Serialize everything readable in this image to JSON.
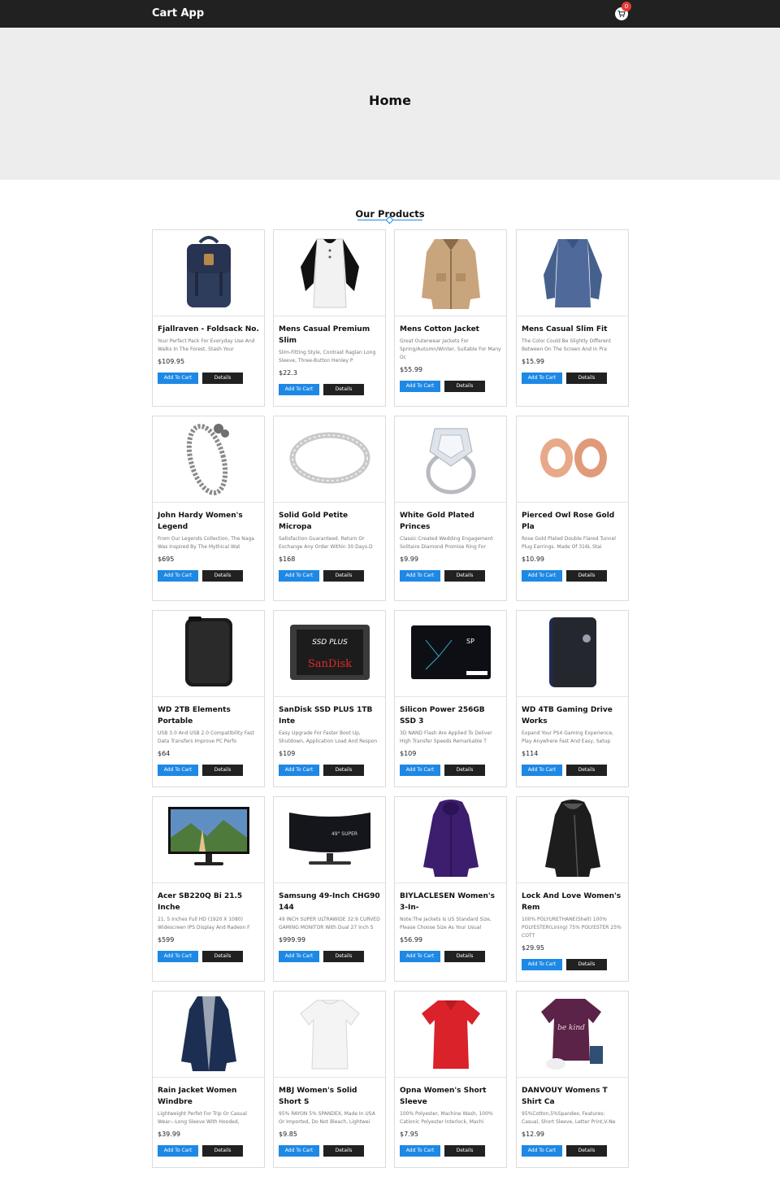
{
  "navbar": {
    "brand": "Cart App",
    "cart_count": "0"
  },
  "hero": {
    "title": "Home"
  },
  "section": {
    "title": "Our Products"
  },
  "buttons": {
    "add": "Add To Cart",
    "details": "Details"
  },
  "products": [
    {
      "title": "Fjallraven - Foldsack No.",
      "desc": "Your Perfect Pack For Everyday Use And Walks In The Forest. Stash Your",
      "price": "$109.95",
      "icon": "backpack"
    },
    {
      "title": "Mens Casual Premium Slim",
      "desc": "Slim-Fitting Style, Contrast Raglan Long Sleeve, Three-Button Henley P",
      "price": "$22.3",
      "icon": "raglan-shirt"
    },
    {
      "title": "Mens Cotton Jacket",
      "desc": "Great Outerwear Jackets For Spring/Autumn/Winter, Suitable For Many Oc",
      "price": "$55.99",
      "icon": "jacket"
    },
    {
      "title": "Mens Casual Slim Fit",
      "desc": "The Color Could Be Slightly Different Between On The Screen And In Pra",
      "price": "$15.99",
      "icon": "longsleeve"
    },
    {
      "title": "John Hardy Women's Legend",
      "desc": "From Our Legends Collection, The Naga Was Inspired By The Mythical Wat",
      "price": "$695",
      "icon": "bracelet"
    },
    {
      "title": "Solid Gold Petite Micropa",
      "desc": "Satisfaction Guaranteed. Return Or Exchange Any Order Within 30 Days.D",
      "price": "$168",
      "icon": "ring"
    },
    {
      "title": "White Gold Plated Princes",
      "desc": "Classic Created Wedding Engagement Solitaire Diamond Promise Ring For",
      "price": "$9.99",
      "icon": "diamond-ring"
    },
    {
      "title": "Pierced Owl Rose Gold Pla",
      "desc": "Rose Gold Plated Double Flared Tunnel Plug Earrings. Made Of 316L Stai",
      "price": "$10.99",
      "icon": "plugs"
    },
    {
      "title": "WD 2TB Elements Portable",
      "desc": "USB 3.0 And USB 2.0 Compatibility Fast Data Transfers Improve PC Perfo",
      "price": "$64",
      "icon": "hdd"
    },
    {
      "title": "SanDisk SSD PLUS 1TB Inte",
      "desc": "Easy Upgrade For Faster Boot Up, Shutdown, Application Load And Respon",
      "price": "$109",
      "icon": "ssd-sandisk"
    },
    {
      "title": "Silicon Power 256GB SSD 3",
      "desc": "3D NAND Flash Are Applied To Deliver High Transfer Speeds Remarkable T",
      "price": "$109",
      "icon": "ssd-sp"
    },
    {
      "title": "WD 4TB Gaming Drive Works",
      "desc": "Expand Your PS4 Gaming Experience, Play Anywhere Fast And Easy, Setup",
      "price": "$114",
      "icon": "gaming-drive"
    },
    {
      "title": "Acer SB220Q Bi 21.5 Inche",
      "desc": "21. 5 Inches Full HD (1920 X 1080) Widescreen IPS Display And Radeon F",
      "price": "$599",
      "icon": "monitor"
    },
    {
      "title": "Samsung 49-Inch CHG90 144",
      "desc": "49 INCH SUPER ULTRAWIDE 32:9 CURVED GAMING MONITOR With Dual 27 Inch S",
      "price": "$999.99",
      "icon": "curved-monitor"
    },
    {
      "title": "BIYLACLESEN Women's 3-In-",
      "desc": "Note:The Jackets Is US Standard Size, Please Choose Size As Your Usual",
      "price": "$56.99",
      "icon": "purple-jacket"
    },
    {
      "title": "Lock And Love Women's Rem",
      "desc": "100% POLYURETHANE(Shell) 100% POLYESTER(Lining) 75% POLYESTER 25% COTT",
      "price": "$29.95",
      "icon": "leather-jacket"
    },
    {
      "title": "Rain Jacket Women Windbre",
      "desc": "Lightweight Perfet For Trip Or Casual Wear---Long Sleeve With Hooded,",
      "price": "$39.99",
      "icon": "rain-jacket"
    },
    {
      "title": "MBJ Women's Solid Short S",
      "desc": "95% RAYON 5% SPANDEX, Made In USA Or Imported, Do Not Bleach, Lightwei",
      "price": "$9.85",
      "icon": "white-tshirt"
    },
    {
      "title": "Opna Women's Short Sleeve",
      "desc": "100% Polyester, Machine Wash, 100% Cationic Polyester Interlock, Machi",
      "price": "$7.95",
      "icon": "red-tshirt"
    },
    {
      "title": "DANVOUY Womens T Shirt Ca",
      "desc": "95%Cotton,5%Spandex, Features: Casual, Short Sleeve, Letter Print,V-Ne",
      "price": "$12.99",
      "icon": "purple-tshirt"
    }
  ]
}
